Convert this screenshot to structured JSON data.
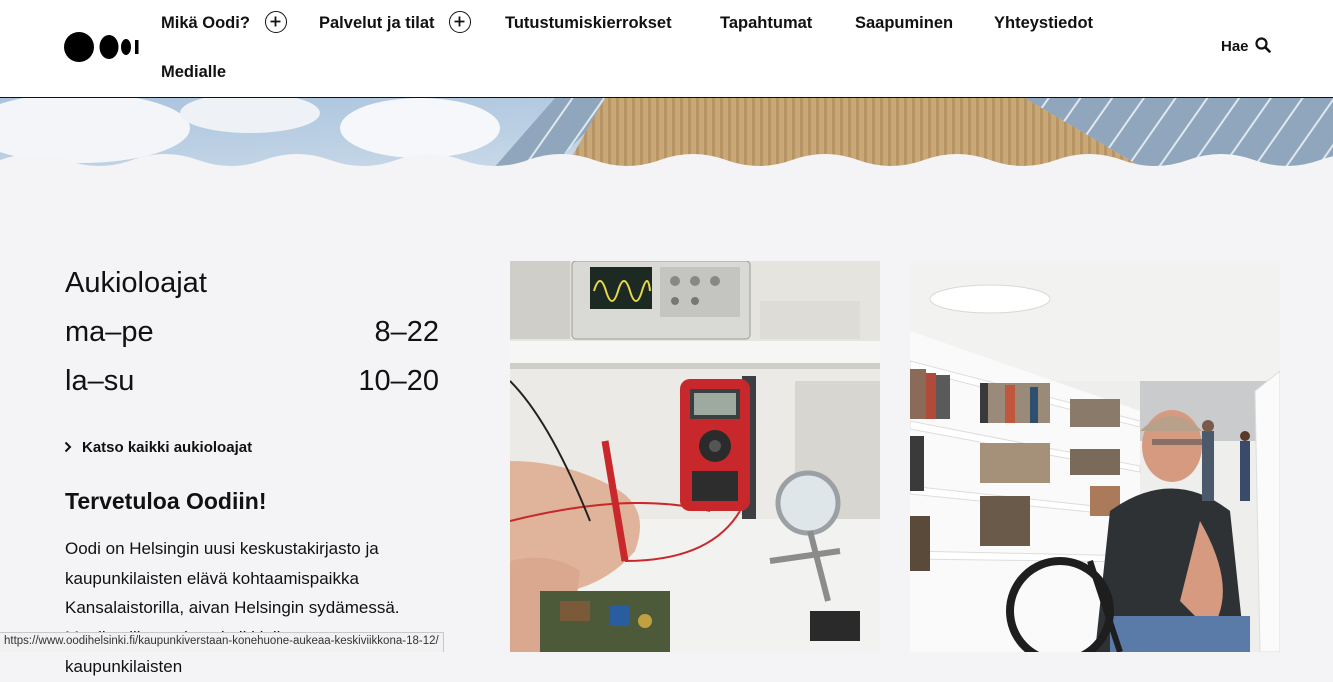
{
  "header": {
    "logo_alt": "Oodi",
    "nav": [
      {
        "label": "Mikä Oodi?",
        "expandable": true
      },
      {
        "label": "Palvelut ja tilat",
        "expandable": true
      },
      {
        "label": "Tutustumiskierrokset",
        "expandable": false
      },
      {
        "label": "Tapahtumat",
        "expandable": false
      },
      {
        "label": "Saapuminen",
        "expandable": false
      },
      {
        "label": "Yhteystiedot",
        "expandable": false
      },
      {
        "label": "Medialle",
        "expandable": false
      }
    ],
    "search_label": "Hae",
    "search_icon": "search-icon",
    "expand_icon": "plus-circle-icon"
  },
  "hours": {
    "title": "Aukioloajat",
    "rows": [
      {
        "days": "ma–pe",
        "time": "8–22"
      },
      {
        "days": "la–su",
        "time": "10–20"
      }
    ],
    "all_link": "Katso kaikki aukioloajat",
    "link_icon": "chevron-right-icon"
  },
  "welcome": {
    "title": "Tervetuloa Oodiin!",
    "lines": [
      "Oodi on Helsingin uusi keskustakirjasto ja",
      "kaupunkilaisten elävä kohtaamispaikka",
      "Kansalaistorilla, aivan Helsingin sydämessä.",
      "Maailmaille tuodaan kaikki tilat ovat kaupunkilaisten"
    ]
  },
  "images": [
    {
      "name": "electronics-workshop-photo"
    },
    {
      "name": "library-shelves-photo"
    }
  ],
  "status_bar": {
    "url": "https://www.oodihelsinki.fi/kaupunkiverstaan-konehuone-aukeaa-keskiviikkona-18-12/"
  },
  "colors": {
    "background": "#f4f4f6",
    "header_bg": "#ffffff",
    "text": "#111111"
  }
}
